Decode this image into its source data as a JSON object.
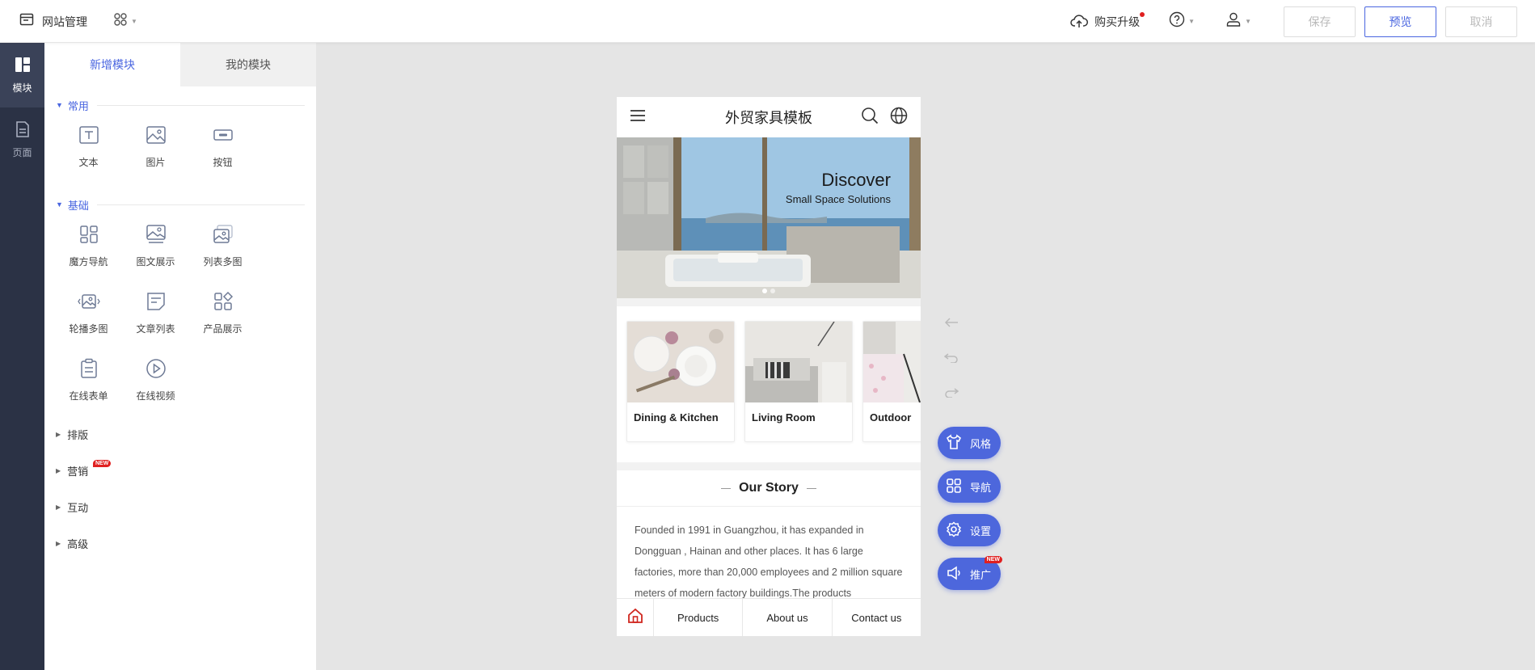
{
  "topbar": {
    "title": "网站管理",
    "upgrade_label": "购买升级",
    "buttons": {
      "save": "保存",
      "preview": "预览",
      "cancel": "取消"
    }
  },
  "rail": {
    "items": [
      {
        "label": "模块"
      },
      {
        "label": "页面"
      }
    ]
  },
  "panel": {
    "tabs": [
      {
        "label": "新增模块"
      },
      {
        "label": "我的模块"
      }
    ],
    "sections": {
      "common": {
        "label": "常用",
        "items": [
          {
            "label": "文本",
            "icon": "text-icon"
          },
          {
            "label": "图片",
            "icon": "image-icon"
          },
          {
            "label": "按钮",
            "icon": "button-icon"
          }
        ]
      },
      "basic": {
        "label": "基础",
        "items": [
          {
            "label": "魔方导航",
            "icon": "cube-nav-icon"
          },
          {
            "label": "图文展示",
            "icon": "image-text-icon"
          },
          {
            "label": "列表多图",
            "icon": "list-images-icon"
          },
          {
            "label": "轮播多图",
            "icon": "carousel-icon"
          },
          {
            "label": "文章列表",
            "icon": "article-list-icon"
          },
          {
            "label": "产品展示",
            "icon": "product-icon"
          },
          {
            "label": "在线表单",
            "icon": "form-icon"
          },
          {
            "label": "在线视频",
            "icon": "video-icon"
          }
        ]
      }
    },
    "collapsed": [
      {
        "label": "排版"
      },
      {
        "label": "营销",
        "badge": "NEW"
      },
      {
        "label": "互动"
      },
      {
        "label": "高级"
      }
    ]
  },
  "phone": {
    "title": "外贸家具模板",
    "banner": {
      "heading": "Discover",
      "subheading": "Small Space Solutions"
    },
    "categories": [
      {
        "label": "Dining & Kitchen"
      },
      {
        "label": "Living Room"
      },
      {
        "label": "Outdoor"
      }
    ],
    "story": {
      "title": "Our Story",
      "text": "Founded in 1991 in Guangzhou, it has expanded in Dongguan , Hainan and other places. It has 6 large factories, more than 20,000 employees and 2 million square meters of modern factory buildings.The products"
    },
    "tabbar": [
      {
        "label": "Products"
      },
      {
        "label": "About us"
      },
      {
        "label": "Contact us"
      }
    ]
  },
  "fabs": [
    {
      "label": "风格",
      "icon": "shirt-icon"
    },
    {
      "label": "导航",
      "icon": "grid-icon"
    },
    {
      "label": "设置",
      "icon": "gear-icon"
    },
    {
      "label": "推广",
      "icon": "megaphone-icon",
      "badge": "NEW"
    }
  ],
  "colors": {
    "accent": "#4a66e0",
    "rail": "#2b3245",
    "fab": "#4d67dc",
    "badge": "#e02020"
  }
}
